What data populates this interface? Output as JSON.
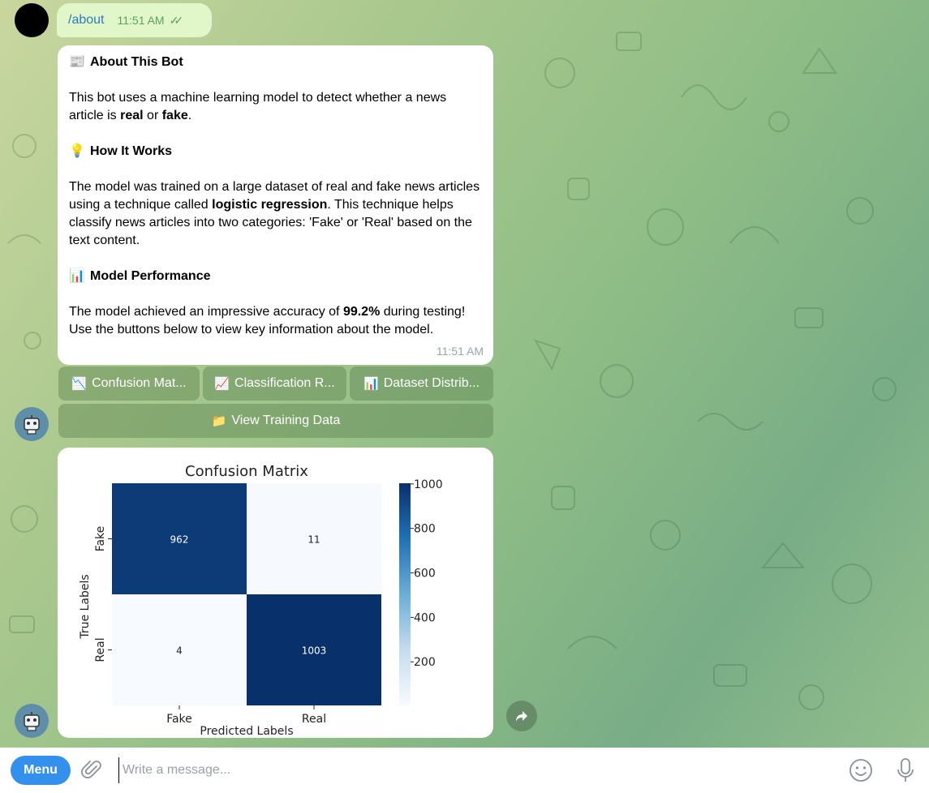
{
  "outgoing": {
    "command": "/about",
    "time": "11:51 AM",
    "status_icon": "double-check-icon"
  },
  "about_message": {
    "title_icon": "📰",
    "title": "About This Bot",
    "intro_pre": "This bot uses a machine learning model to detect whether a news article is ",
    "intro_bold1": "real",
    "intro_mid": " or ",
    "intro_bold2": "fake",
    "intro_post": ".",
    "how_icon": "💡",
    "how_title": "How It Works",
    "how_pre": "The model was trained on a large dataset of real and fake news articles using a technique called ",
    "how_bold": "logistic regression",
    "how_post": ". This technique helps classify news articles into two categories: 'Fake' or 'Real' based on the text content.",
    "perf_icon": "📊",
    "perf_title": "Model Performance",
    "perf_pre": "The model achieved an impressive accuracy of ",
    "perf_bold": "99.2%",
    "perf_post": " during testing! Use the buttons below to view key information about the model.",
    "time": "11:51 AM"
  },
  "keyboard": {
    "confusion_icon": "📉",
    "confusion_label": "Confusion Mat...",
    "report_icon": "📈",
    "report_label": "Classification R...",
    "dataset_icon": "📊",
    "dataset_label": "Dataset Distrib...",
    "training_icon": "📁",
    "training_label": "View Training Data"
  },
  "chart_data": {
    "type": "heatmap",
    "title": "Confusion Matrix",
    "xlabel": "Predicted Labels",
    "ylabel": "True Labels",
    "x_categories": [
      "Fake",
      "Real"
    ],
    "y_categories": [
      "Fake",
      "Real"
    ],
    "values": [
      [
        962,
        11
      ],
      [
        4,
        1003
      ]
    ],
    "colormap": "Blues",
    "colorbar_ticks": [
      "1000",
      "800",
      "600",
      "400",
      "200"
    ],
    "colorbar_range": [
      4,
      1003
    ]
  },
  "composer": {
    "menu_label": "Menu",
    "placeholder": "Write a message..."
  },
  "colors": {
    "accent": "#3390ec",
    "outgoing_bubble": "#e1f7c9",
    "heat_dark": "#08306b",
    "heat_light": "#f7fbff"
  }
}
